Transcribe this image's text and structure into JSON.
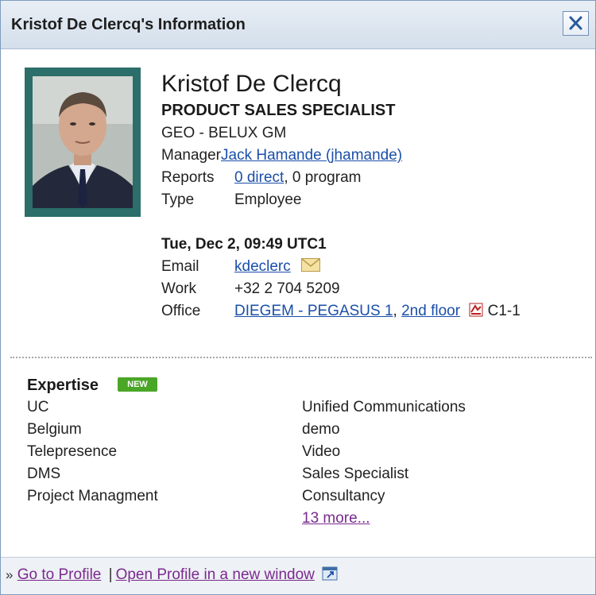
{
  "window": {
    "title": "Kristof De Clercq's Information"
  },
  "profile": {
    "name": "Kristof De Clercq",
    "job_title": "PRODUCT SALES SPECIALIST",
    "org": "GEO - BELUX GM",
    "manager_label": "Manager",
    "manager_value": "Jack Hamande (jhamande)",
    "reports_label": "Reports",
    "reports_direct": "0 direct",
    "reports_program": ", 0 program",
    "type_label": "Type",
    "type_value": "Employee"
  },
  "contact": {
    "time": "Tue, Dec 2, 09:49 UTC1",
    "email_label": "Email",
    "email_value": "kdeclerc",
    "work_label": "Work",
    "work_value": "+32 2 704 5209",
    "office_label": "Office",
    "office_building": "DIEGEM - PEGASUS 1",
    "office_comma": ",",
    "office_floor": "2nd floor",
    "office_room": "C1-1"
  },
  "expertise": {
    "heading": "Expertise",
    "badge": "NEW",
    "left": [
      "UC",
      "Belgium",
      "Telepresence",
      "DMS",
      "Project Managment"
    ],
    "right": [
      "Unified Communications",
      "demo",
      "Video",
      "Sales Specialist",
      "Consultancy"
    ],
    "more_link": "13 more..."
  },
  "footer": {
    "arrows": "»",
    "go_to_profile": "Go to Profile",
    "separator": "|",
    "open_new_window": "Open Profile in a new window"
  },
  "icons": {
    "close": "close-icon",
    "email": "envelope-icon",
    "map": "floor-plan-icon",
    "external": "external-window-icon"
  }
}
